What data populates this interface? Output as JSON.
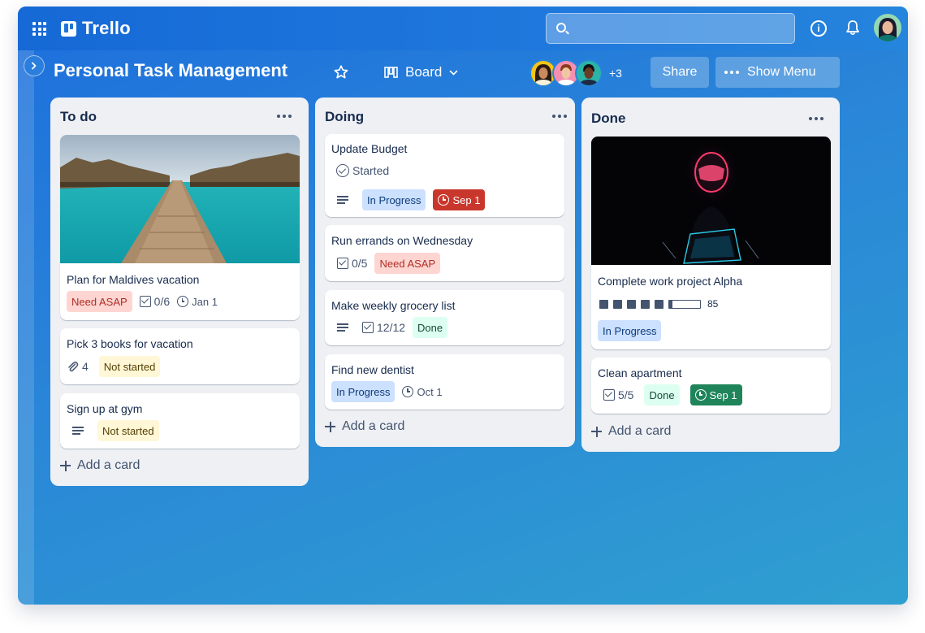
{
  "app": {
    "name": "Trello"
  },
  "board": {
    "title": "Personal Task Management",
    "view_label": "Board",
    "more_members": "+3",
    "share_label": "Share",
    "show_menu_label": "Show Menu"
  },
  "lists": [
    {
      "title": "To do",
      "add_card_label": "Add a card",
      "cards": [
        {
          "title": "Plan for Maldives vacation",
          "cover": "overwater-villas-photo",
          "label": "Need ASAP",
          "checklist": "0/6",
          "due": "Jan 1"
        },
        {
          "title": "Pick 3 books for vacation",
          "attachments": "4",
          "label": "Not started"
        },
        {
          "title": "Sign up at gym",
          "label": "Not started"
        }
      ]
    },
    {
      "title": "Doing",
      "add_card_label": "Add a card",
      "cards": [
        {
          "title": "Update Budget",
          "status": "Started",
          "label": "In Progress",
          "due": "Sep 1"
        },
        {
          "title": "Run errands on Wednesday",
          "checklist": "0/5",
          "label": "Need ASAP"
        },
        {
          "title": "Make weekly grocery list",
          "checklist": "12/12",
          "label": "Done"
        },
        {
          "title": "Find new dentist",
          "label": "In Progress",
          "due": "Oct 1"
        }
      ]
    },
    {
      "title": "Done",
      "add_card_label": "Add a card",
      "cards": [
        {
          "title": "Complete work project Alpha",
          "cover": "neon-helmet-photo",
          "progress": 85,
          "progress_label": "85",
          "label": "In Progress"
        },
        {
          "title": "Clean apartment",
          "checklist": "5/5",
          "label": "Done",
          "due": "Sep 1"
        }
      ]
    }
  ],
  "colors": {
    "header_blue": "#1669d6",
    "label_red": "#ffd5d2",
    "label_yellow": "#fff7d6",
    "label_blue": "#cce0ff",
    "label_green": "#dcfff1",
    "due_overdue": "#c9372c",
    "due_complete": "#1f845a"
  }
}
